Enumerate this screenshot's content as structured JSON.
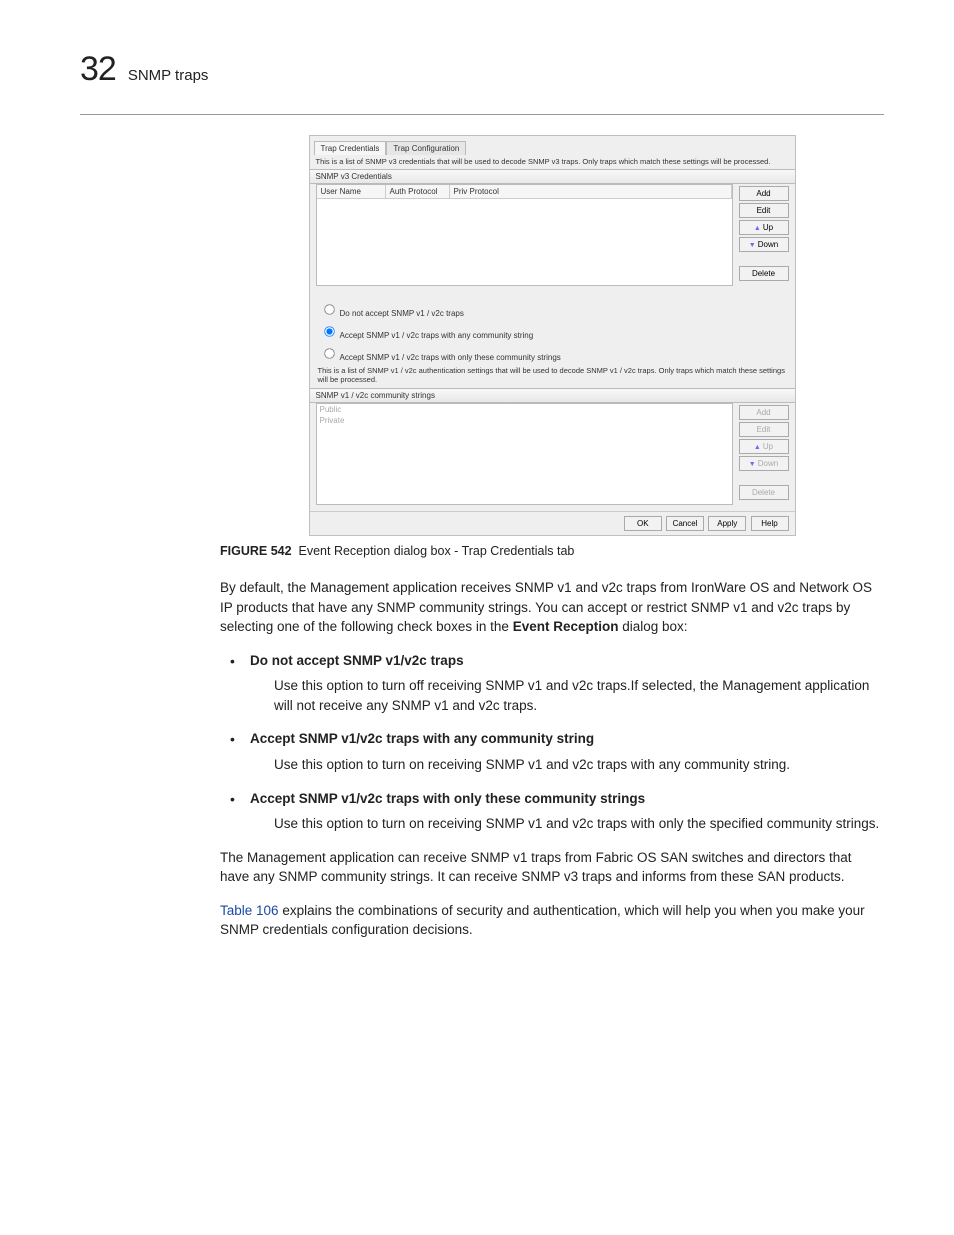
{
  "header": {
    "chapter_number": "32",
    "running_title": "SNMP traps"
  },
  "dialog": {
    "tabs": {
      "active": "Trap Credentials",
      "inactive": "Trap Configuration"
    },
    "desc1": "This is a list of SNMP v3 credentials that will be used to decode SNMP v3 traps. Only traps which match these settings will be processed.",
    "section1": "SNMP v3 Credentials",
    "cols": {
      "c1": "User Name",
      "c2": "Auth Protocol",
      "c3": "Priv Protocol"
    },
    "btns": {
      "add": "Add",
      "edit": "Edit",
      "up": "Up",
      "down": "Down",
      "del": "Delete"
    },
    "radio1": "Do not accept SNMP v1 / v2c traps",
    "radio2": "Accept SNMP v1 / v2c traps with any community string",
    "radio3": "Accept SNMP v1 / v2c traps with only these community strings",
    "desc2": "This is a list of SNMP v1 / v2c authentication settings that will be used to decode SNMP v1 / v2c traps. Only traps which match these settings will be processed.",
    "section2": "SNMP v1 / v2c community strings",
    "list": {
      "i1": "Public",
      "i2": "Private"
    },
    "footer": {
      "ok": "OK",
      "cancel": "Cancel",
      "apply": "Apply",
      "help": "Help"
    }
  },
  "figure": {
    "label": "FIGURE 542",
    "title": "Event Reception dialog box - Trap Credentials tab"
  },
  "para1_a": "By default, the Management application receives SNMP v1 and v2c traps from IronWare OS and Network OS IP products that have any SNMP community strings. You can accept or restrict SNMP v1 and v2c traps by selecting one of the following check boxes in the ",
  "para1_b": "Event Reception",
  "para1_c": " dialog box:",
  "opts": [
    {
      "name": "Do not accept SNMP v1/v2c traps",
      "desc": "Use this option to turn off receiving SNMP v1 and v2c traps.If selected, the Management application will not receive any SNMP v1 and v2c traps."
    },
    {
      "name": "Accept SNMP v1/v2c traps with any community string",
      "desc": "Use this option to turn on receiving SNMP v1 and v2c traps with any community string."
    },
    {
      "name": "Accept SNMP v1/v2c traps with only these community strings",
      "desc": "Use this option to turn on receiving SNMP v1 and v2c traps with only the specified community strings."
    }
  ],
  "para2": "The Management application can receive SNMP v1 traps from Fabric OS SAN switches and directors that have any SNMP community strings. It can receive SNMP v3 traps and informs from these SAN products.",
  "para3_link": "Table 106",
  "para3_rest": " explains the combinations of security and authentication, which will help you when you make your SNMP credentials configuration decisions."
}
